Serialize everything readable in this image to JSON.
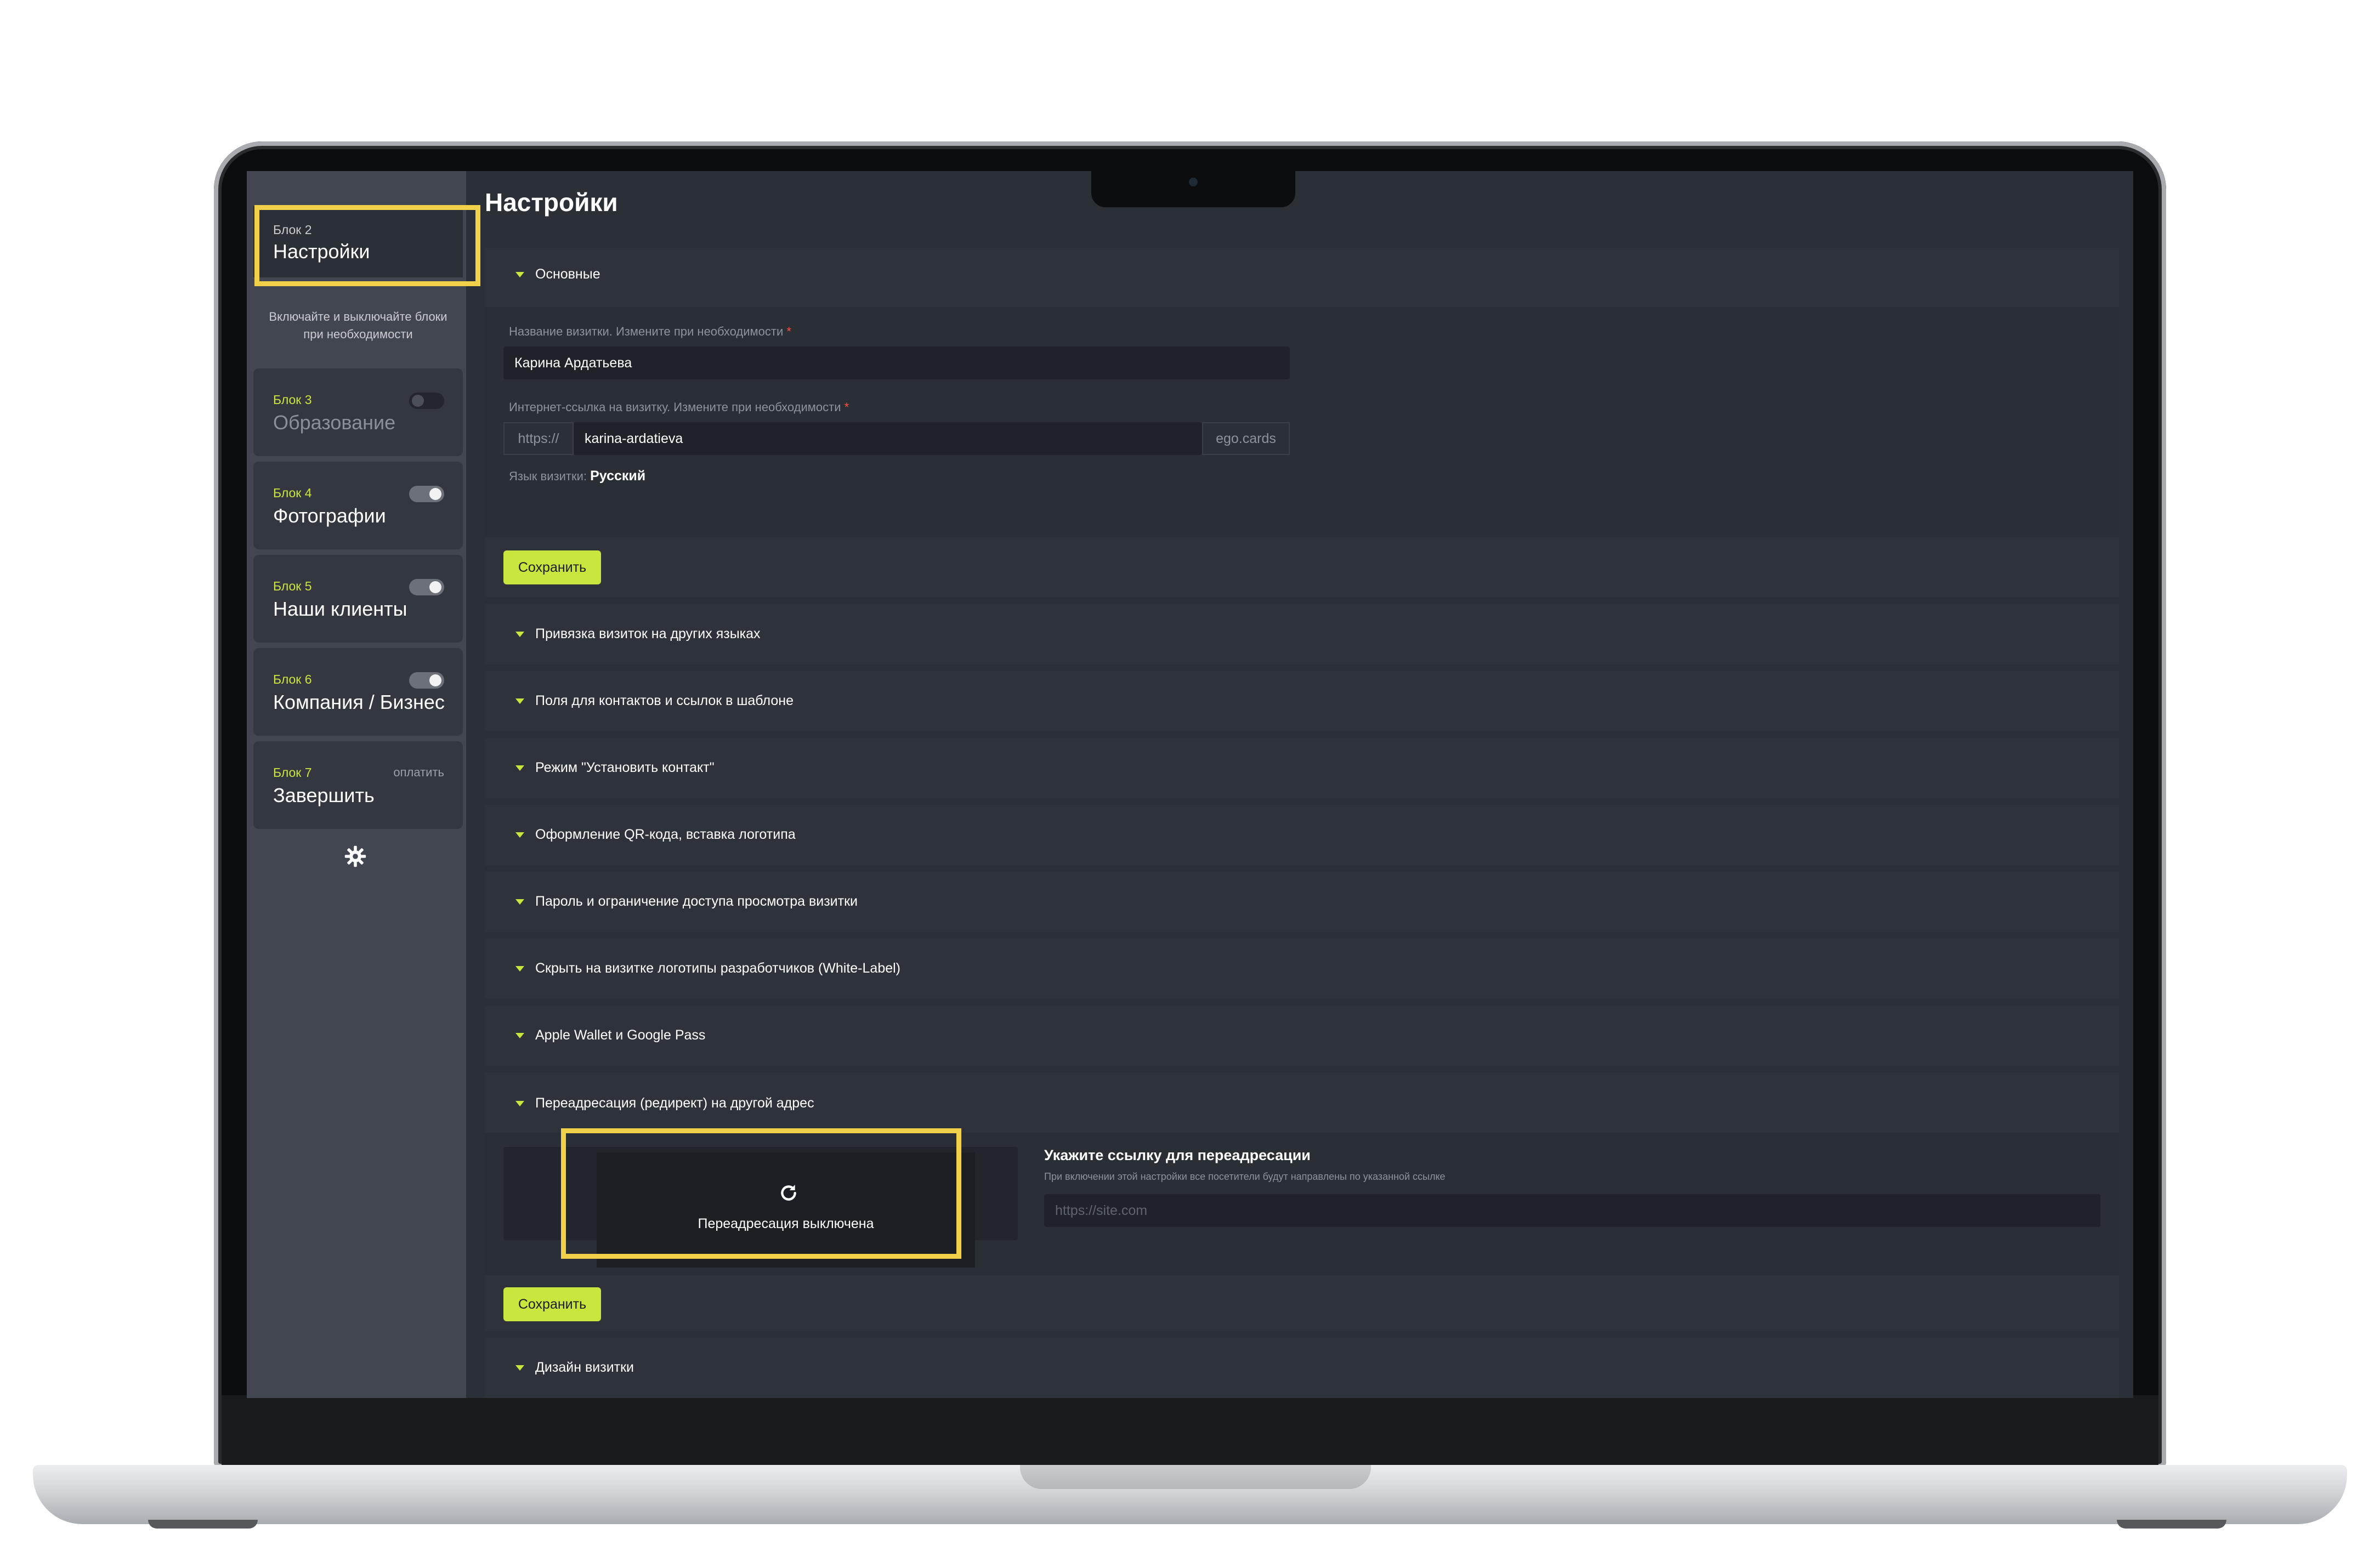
{
  "sidebar": {
    "active_block": {
      "label": "Блок 2",
      "title": "Настройки"
    },
    "hint": "Включайте и выключайте блоки при необходимости",
    "blocks": [
      {
        "label": "Блок 3",
        "title": "Образование",
        "toggle": "off"
      },
      {
        "label": "Блок 4",
        "title": "Фотографии",
        "toggle": "on"
      },
      {
        "label": "Блок 5",
        "title": "Наши клиенты",
        "toggle": "on"
      },
      {
        "label": "Блок 6",
        "title": "Компания / Бизнес",
        "toggle": "on"
      },
      {
        "label": "Блок 7",
        "title": "Завершить",
        "pay": "оплатить"
      }
    ],
    "settings_icon": "gear-icon"
  },
  "main": {
    "title": "Настройки",
    "basic": {
      "heading": "Основные",
      "name_label": "Название визитки. Измените при необходимости",
      "name_value": "Карина Ардатьева",
      "url_label": "Интернет-ссылка на визитку. Измените при необходимости",
      "url_prefix": "https://",
      "url_value": "karina-ardatieva",
      "url_suffix": "ego.cards",
      "lang_label": "Язык визитки:",
      "lang_value": "Русский",
      "required_mark": "*",
      "save_label": "Сохранить"
    },
    "sections": [
      "Привязка визиток на других языках",
      "Поля для контактов и ссылок в шаблоне",
      "Режим \"Установить контакт\"",
      "Оформление QR-кода, вставка логотипа",
      "Пароль и ограничение доступа просмотра визитки",
      "Скрыть на визитке логотипы разработчиков (White-Label)",
      "Apple Wallet и Google Pass"
    ],
    "redirect": {
      "heading": "Переадресация (редирект) на другой адрес",
      "status": "Переадресация выключена",
      "title": "Укажите ссылку для переадресации",
      "subtitle": "При включении этой настройки все посетители будут направлены по указанной ссылке",
      "placeholder": "https://site.com",
      "save_label": "Сохранить"
    },
    "design": {
      "heading": "Дизайн визитки"
    }
  },
  "colors": {
    "accent": "#c8e63d",
    "highlight": "#f2d14a",
    "background": "#2b2f36",
    "sidebar": "#414651"
  }
}
